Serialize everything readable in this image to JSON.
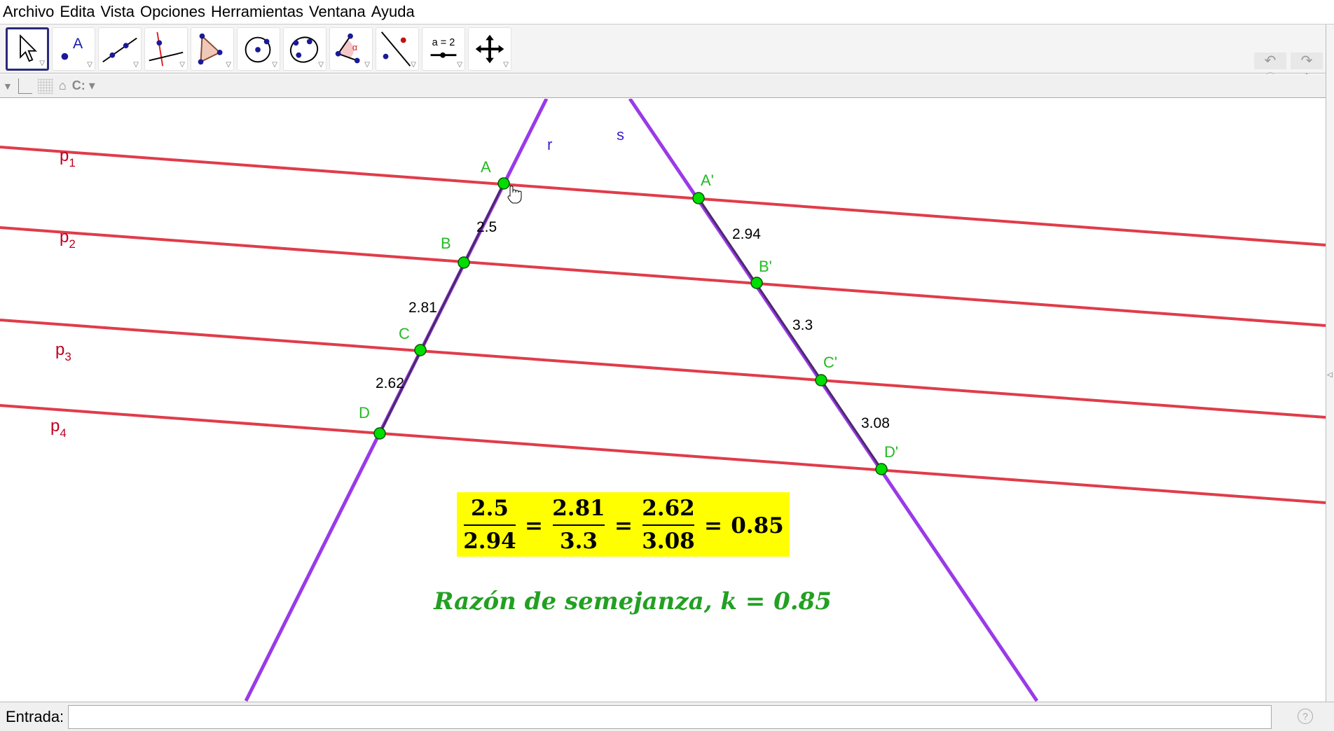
{
  "menu": [
    "Archivo",
    "Edita",
    "Vista",
    "Opciones",
    "Herramientas",
    "Ventana",
    "Ayuda"
  ],
  "toolbar": {
    "tools": [
      "move",
      "point",
      "line",
      "perpendicular",
      "polygon",
      "circle",
      "conic",
      "angle",
      "reflect",
      "slider",
      "move-view"
    ],
    "slider_label": "a = 2",
    "point_letter": "A",
    "angle_letter": "α"
  },
  "stylebar": {
    "label": "C:"
  },
  "canvas": {
    "lines": {
      "r": "r",
      "s": "s"
    },
    "parallels": [
      {
        "name": "p",
        "sub": "1"
      },
      {
        "name": "p",
        "sub": "2"
      },
      {
        "name": "p",
        "sub": "3"
      },
      {
        "name": "p",
        "sub": "4"
      }
    ],
    "points": [
      "A",
      "B",
      "C",
      "D",
      "A'",
      "B'",
      "C'",
      "D'"
    ],
    "segments": [
      "2.5",
      "2.81",
      "2.62",
      "2.94",
      "3.3",
      "3.08"
    ],
    "formula": {
      "n1": "2.5",
      "d1": "2.94",
      "n2": "2.81",
      "d2": "3.3",
      "n3": "2.62",
      "d3": "3.08",
      "eq": "=",
      "result": "0.85"
    },
    "caption": "Razón de semejanza,",
    "caption_k": "k = 0.85"
  },
  "colors": {
    "parallel": "#e03c4a",
    "transversal": "#9a3ae8",
    "point": "#00dd00",
    "formula_bg": "#ffff00",
    "caption": "#22a022"
  },
  "input": {
    "label": "Entrada:",
    "value": ""
  }
}
